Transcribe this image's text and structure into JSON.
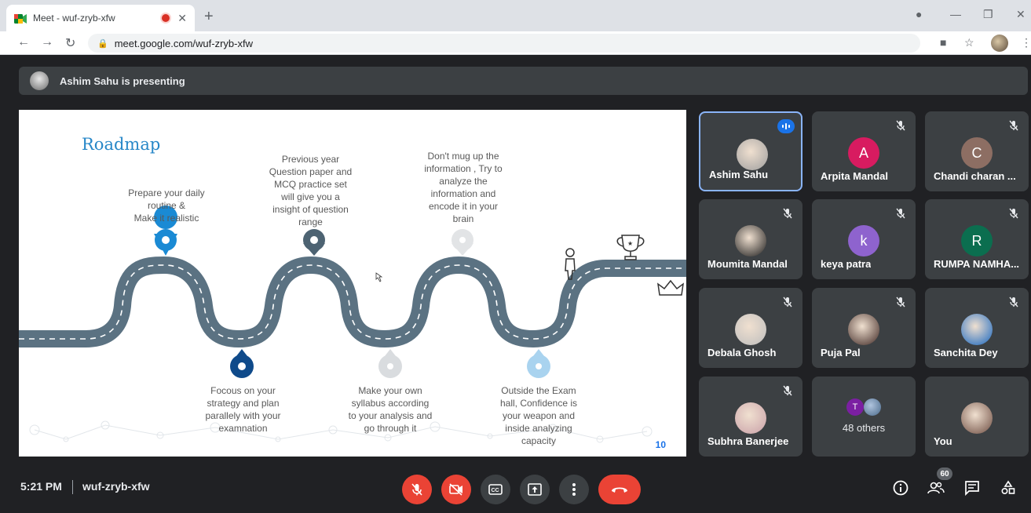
{
  "browser": {
    "tab_title": "Meet - wuf-zryb-xfw",
    "url": "meet.google.com/wuf-zryb-xfw"
  },
  "meet": {
    "presenting_text": "Ashim Sahu is presenting",
    "time": "5:21 PM",
    "meeting_code": "wuf-zryb-xfw",
    "participant_count": "60"
  },
  "slide": {
    "title": "Roadmap",
    "page_number": "10",
    "captions": [
      "Prepare your daily\nroutine &\nMake it realistic",
      "Previous year\nQuestion paper and\nMCQ practice set\nwill give you a\ninsight of question\nrange",
      "Don't mug up the\ninformation , Try to\nanalyze the\ninformation and\nencode it in your\nbrain",
      "Focous on your\nstrategy and plan\nparallely with  your\nexamnation",
      "Make your own\nsyllabus according\nto your analysis and\ngo through it",
      "Outside the Exam\nhall, Confidence  is\nyour weapon and\ninside analyzing\ncapacity"
    ]
  },
  "participants": [
    {
      "name": "Ashim Sahu",
      "initial": "",
      "color": "#9e9e9e",
      "active": true
    },
    {
      "name": "Arpita Mandal",
      "initial": "A",
      "color": "#d81b60",
      "active": false
    },
    {
      "name": "Chandi charan ...",
      "initial": "C",
      "color": "#8d6e63",
      "active": false
    },
    {
      "name": "Moumita Mandal",
      "initial": "",
      "color": "#1c1c1c",
      "active": false
    },
    {
      "name": "keya patra",
      "initial": "k",
      "color": "#8e63ce",
      "active": false
    },
    {
      "name": "RUMPA NAMHA...",
      "initial": "R",
      "color": "#0b6e4f",
      "active": false
    },
    {
      "name": "Debala Ghosh",
      "initial": "",
      "color": "#bdbdbd",
      "active": false
    },
    {
      "name": "Puja Pal",
      "initial": "",
      "color": "#3e2723",
      "active": false
    },
    {
      "name": "Sanchita Dey",
      "initial": "",
      "color": "#1565c0",
      "active": false
    },
    {
      "name": "Subhra Banerjee",
      "initial": "",
      "color": "#c9a0a8",
      "active": false
    },
    {
      "name": "48 others",
      "initial": "T",
      "color": "#7b1fa2",
      "active": false
    },
    {
      "name": "You",
      "initial": "",
      "color": "#6d4c41",
      "active": false
    }
  ],
  "colors": {
    "meet_bg": "#202124",
    "tile_bg": "#3c4043",
    "danger": "#ea4335",
    "slide_accent": "#2787c8",
    "road": "#5b7282"
  }
}
